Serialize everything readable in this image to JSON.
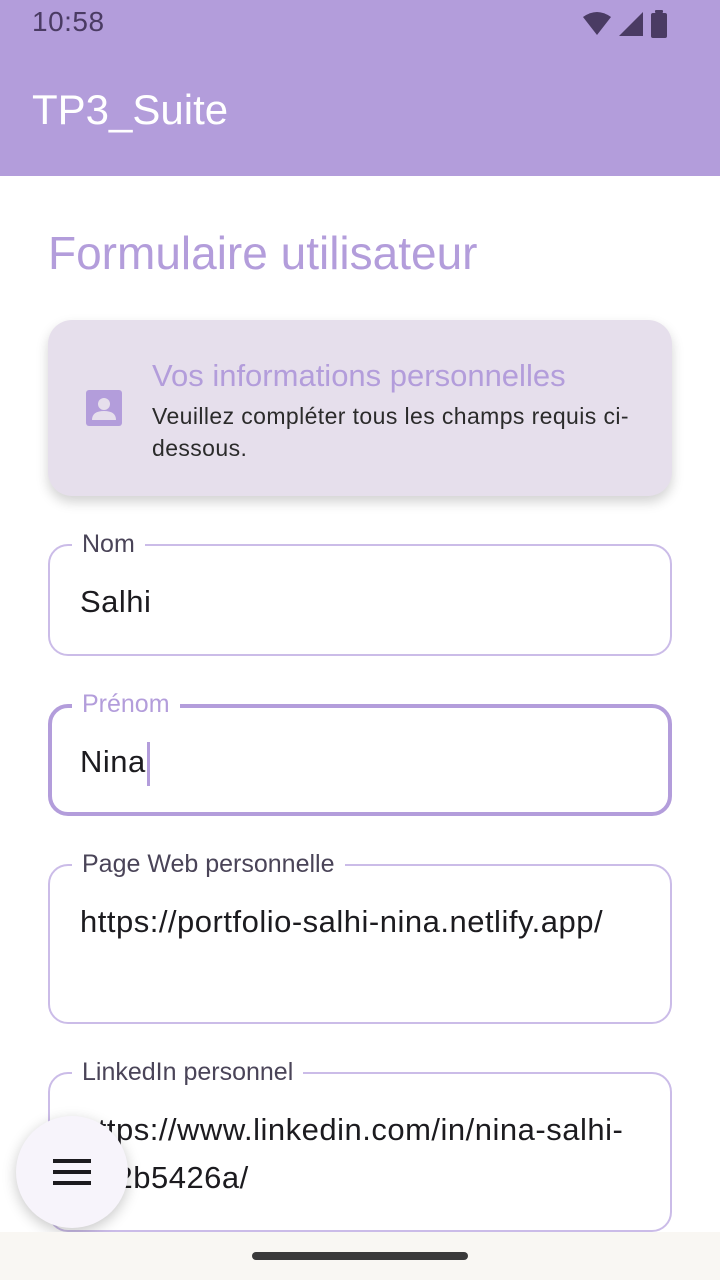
{
  "status_bar": {
    "time": "10:58",
    "icons": [
      "wifi-icon",
      "cellular-signal-icon",
      "battery-icon"
    ]
  },
  "app_bar": {
    "title": "TP3_Suite"
  },
  "page": {
    "title": "Formulaire utilisateur"
  },
  "info_card": {
    "icon": "account-box-icon",
    "title": "Vos informations personnelles",
    "description": "Veuillez compléter tous les champs requis ci-dessous."
  },
  "form": {
    "fields": [
      {
        "label": "Nom",
        "value": "Salhi"
      },
      {
        "label": "Prénom",
        "value": "Nina"
      },
      {
        "label": "Page Web personnelle",
        "value": "https://portfolio-salhi-nina.netlify.app/"
      },
      {
        "label": "LinkedIn personnel",
        "value": "https://www.linkedin.com/in/nina-salhi-812b5426a/"
      }
    ]
  },
  "fab": {
    "icon": "menu-icon"
  },
  "colors": {
    "primary": "#b39ddb",
    "card_background": "#e6dfec",
    "outline": "#cbbce8",
    "text": "#1c1b1f"
  }
}
